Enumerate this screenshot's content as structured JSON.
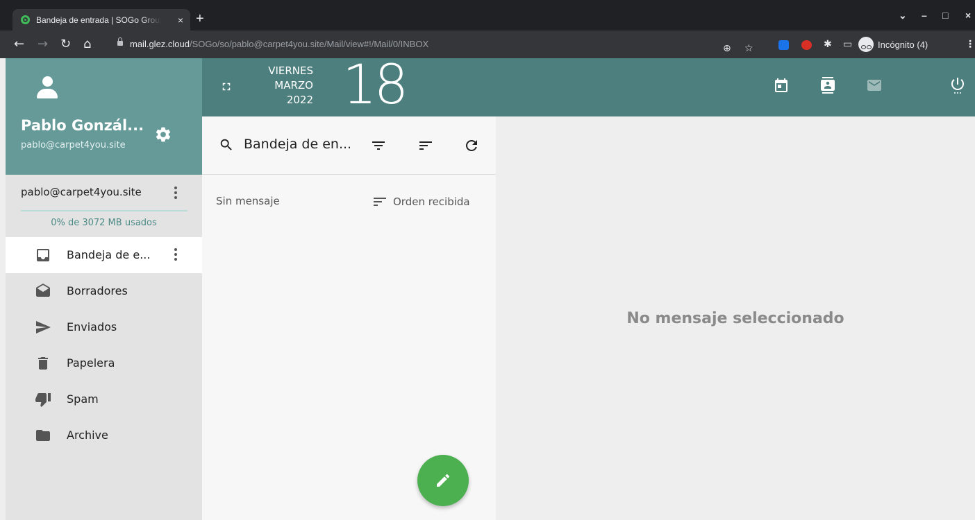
{
  "browser": {
    "tab_title": "Bandeja de entrada | SOGo Groupware",
    "tab_close": "×",
    "new_tab": "+",
    "url_host": "mail.glez.cloud",
    "url_path": "/SOGo/so/pablo@carpet4you.site/Mail/view#!/Mail/0/INBOX",
    "incognito_label": "Incógnito (4)",
    "window_controls": [
      "⌄",
      "–",
      "□",
      "×"
    ],
    "ext_colors": [
      "#1a73e8",
      "#d93025"
    ]
  },
  "user": {
    "name": "Pablo Gonzál...",
    "email": "pablo@carpet4you.site"
  },
  "account": {
    "name": "pablo@carpet4you.site",
    "quota_text": "0% de 3072 MB usados",
    "quota_fraction": 0.0
  },
  "folders": [
    {
      "label": "Bandeja de e...",
      "icon": "inbox-icon",
      "active": true
    },
    {
      "label": "Borradores",
      "icon": "drafts-icon",
      "active": false
    },
    {
      "label": "Enviados",
      "icon": "send-icon",
      "active": false
    },
    {
      "label": "Papelera",
      "icon": "trash-icon",
      "active": false
    },
    {
      "label": "Spam",
      "icon": "thumb-down-icon",
      "active": false
    },
    {
      "label": "Archive",
      "icon": "folder-icon",
      "active": false
    }
  ],
  "date": {
    "weekday": "VIERNES",
    "month": "MARZO",
    "year": "2022",
    "day": "18"
  },
  "list": {
    "folder_title": "Bandeja de en...",
    "empty_text": "Sin mensaje",
    "sort_label": "Orden recibida"
  },
  "viewer": {
    "empty_text": "No mensaje seleccionado"
  },
  "colors": {
    "sidebar_header": "#659a99",
    "top_band": "#4c7f7e",
    "fab": "#4caf50",
    "quota": "#4e8b87"
  }
}
